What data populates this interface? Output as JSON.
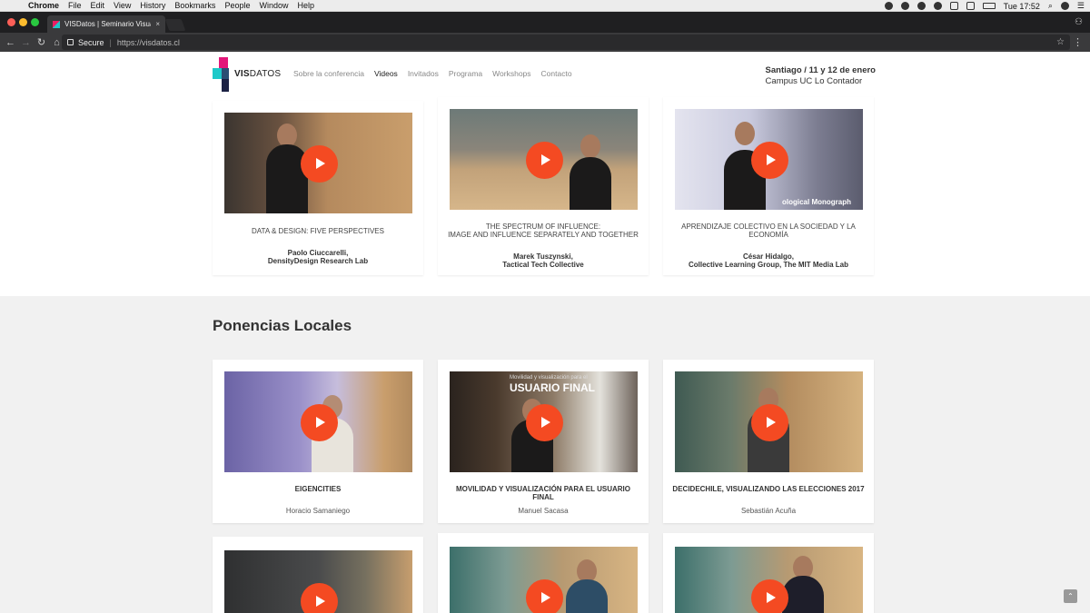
{
  "menubar": {
    "app": "Chrome",
    "items": [
      "File",
      "Edit",
      "View",
      "History",
      "Bookmarks",
      "People",
      "Window",
      "Help"
    ],
    "clock": "Tue 17:52"
  },
  "browser": {
    "tab_title": "VISDatos | Seminario Visualiza",
    "tab_close": "×",
    "secure_label": "Secure",
    "url": "https://visdatos.cl"
  },
  "site": {
    "logo_bold": "VIS",
    "logo_rest": "DATOS",
    "nav": [
      "Sobre la conferencia",
      "Videos",
      "Invitados",
      "Programa",
      "Workshops",
      "Contacto"
    ],
    "active_nav": "Videos",
    "event_date": "Santiago / 11 y 12 de enero",
    "event_place": "Campus UC Lo Contador"
  },
  "invited_talks": [
    {
      "title": "DATA & DESIGN: FIVE PERSPECTIVES",
      "speaker": "Paolo Ciuccarelli,",
      "org": "DensityDesign Research Lab"
    },
    {
      "title": "THE SPECTRUM OF INFLUENCE:\nIMAGE AND INFLUENCE SEPARATELY AND TOGETHER",
      "speaker": "Marek Tuszynski,",
      "org": "Tactical Tech Collective"
    },
    {
      "title": "APRENDIZAJE COLECTIVO EN LA SOCIEDAD Y LA ECONOMÍA",
      "speaker": "César Hidalgo,",
      "org": "Collective Learning Group, The MIT Media Lab"
    }
  ],
  "local_section_title": "Ponencias Locales",
  "local_talks": [
    {
      "title": "EIGENCITIES",
      "speaker": "Horacio Samaniego"
    },
    {
      "title": "MOVILIDAD Y VISUALIZACIÓN PARA EL USUARIO FINAL",
      "speaker": "Manuel Sacasa"
    },
    {
      "title": "DECIDECHILE, VISUALIZANDO LAS ELECCIONES 2017",
      "speaker": "Sebastián Acuña"
    }
  ],
  "thumb_text": {
    "slide_curve": "ological Monograph",
    "slide_final": "USUARIO FINAL",
    "slide_final_sub": "Movilidad y visualización para el"
  },
  "colors": {
    "accent": "#f44a22",
    "logo_pink": "#e3177a",
    "logo_teal": "#1ec9c9",
    "logo_navy": "#1c2244"
  }
}
